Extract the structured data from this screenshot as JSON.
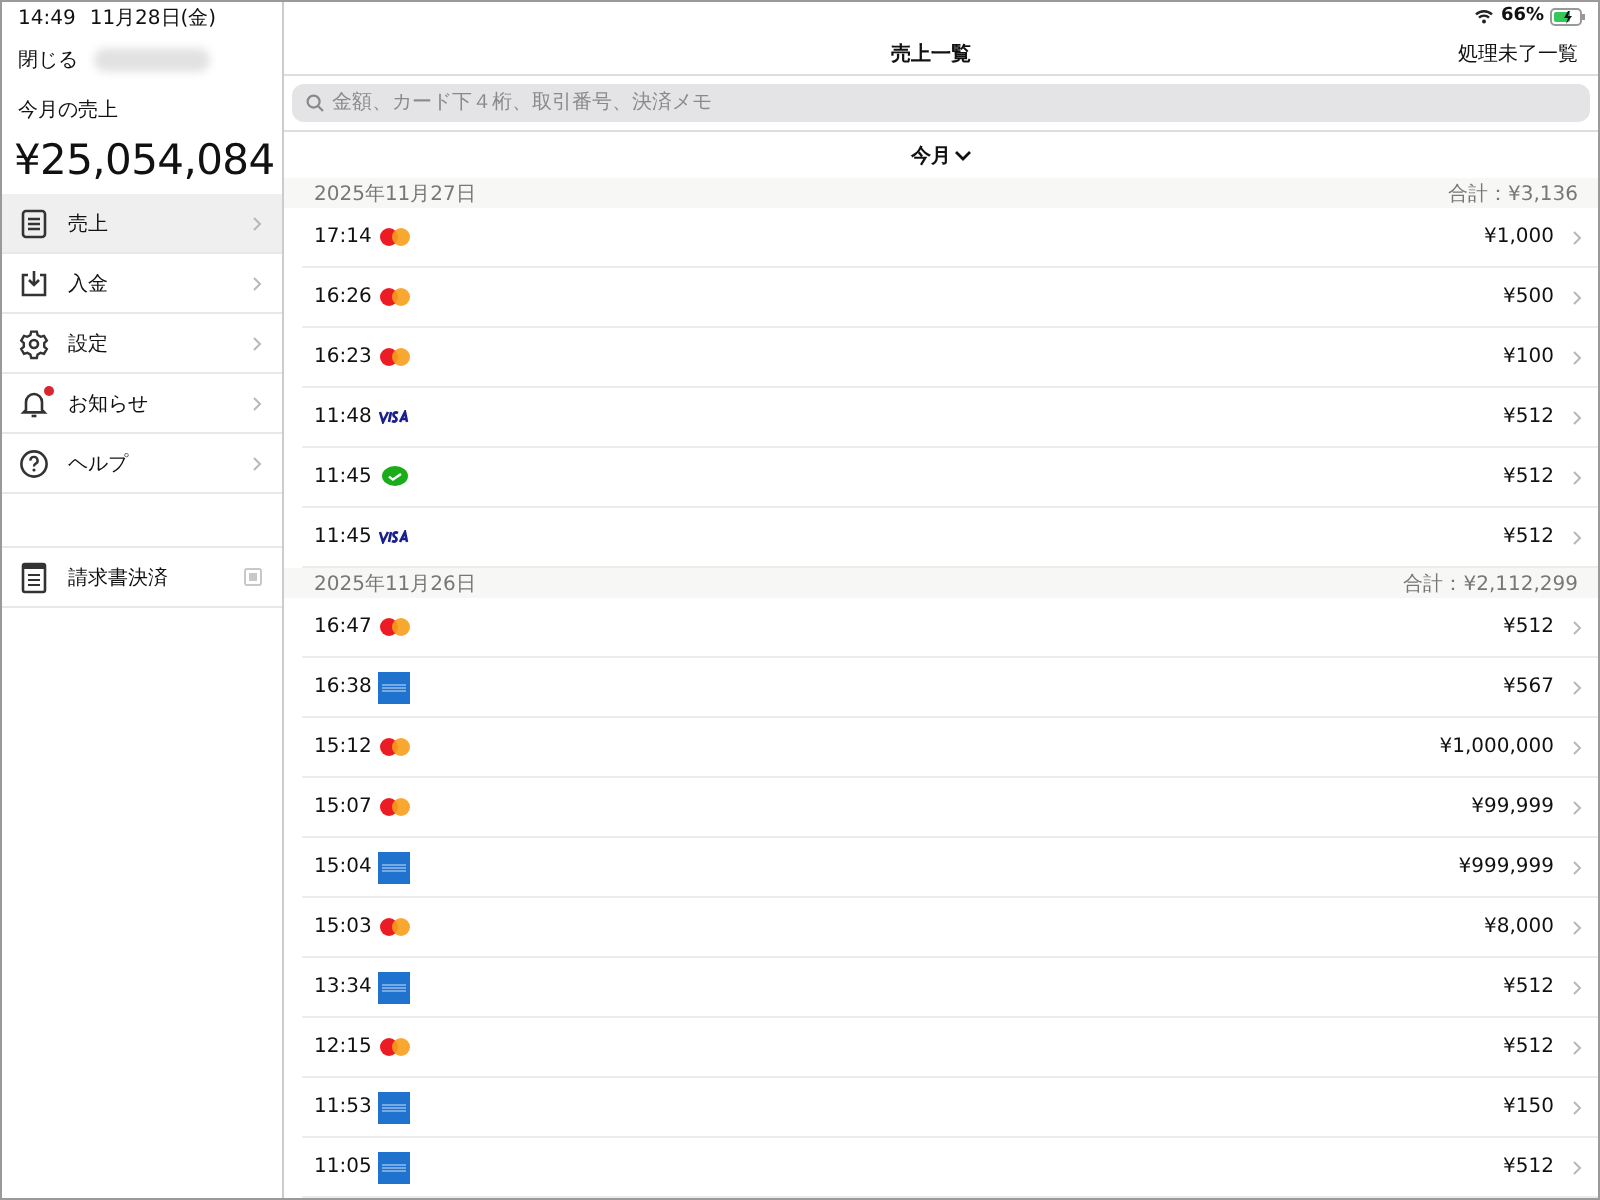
{
  "status_bar": {
    "time": "14:49",
    "date": "11月28日(金)",
    "battery": "66%"
  },
  "sidebar": {
    "close": "閉じる",
    "sales_label": "今月の売上",
    "sales_amount": "¥25,054,084",
    "items": [
      {
        "label": "売上",
        "kind": "document",
        "selected": true,
        "badge": false,
        "external": false
      },
      {
        "label": "入金",
        "kind": "download",
        "selected": false,
        "badge": false,
        "external": false
      },
      {
        "label": "設定",
        "kind": "gear",
        "selected": false,
        "badge": false,
        "external": false
      },
      {
        "label": "お知らせ",
        "kind": "bell",
        "selected": false,
        "badge": true,
        "external": false
      },
      {
        "label": "ヘルプ",
        "kind": "help",
        "selected": false,
        "badge": false,
        "external": false
      }
    ],
    "extra_items": [
      {
        "label": "請求書決済",
        "kind": "invoice",
        "selected": false,
        "badge": false,
        "external": true
      }
    ]
  },
  "header": {
    "title": "売上一覧",
    "action": "処理未了一覧"
  },
  "search": {
    "placeholder": "金額、カード下４桁、取引番号、決済メモ"
  },
  "period": {
    "label": "今月"
  },
  "sections": [
    {
      "date": "2025年11月27日",
      "total": "合計：¥3,136",
      "rows": [
        {
          "time": "17:14",
          "kind": "mastercard",
          "amount": "¥1,000"
        },
        {
          "time": "16:26",
          "kind": "mastercard",
          "amount": "¥500"
        },
        {
          "time": "16:23",
          "kind": "mastercard",
          "amount": "¥100"
        },
        {
          "time": "11:48",
          "kind": "visa",
          "amount": "¥512"
        },
        {
          "time": "11:45",
          "kind": "wechat",
          "amount": "¥512"
        },
        {
          "time": "11:45",
          "kind": "visa",
          "amount": "¥512"
        }
      ]
    },
    {
      "date": "2025年11月26日",
      "total": "合計：¥2,112,299",
      "rows": [
        {
          "time": "16:47",
          "kind": "mastercard",
          "amount": "¥512"
        },
        {
          "time": "16:38",
          "kind": "amex",
          "amount": "¥567"
        },
        {
          "time": "15:12",
          "kind": "mastercard",
          "amount": "¥1,000,000"
        },
        {
          "time": "15:07",
          "kind": "mastercard",
          "amount": "¥99,999"
        },
        {
          "time": "15:04",
          "kind": "amex",
          "amount": "¥999,999"
        },
        {
          "time": "15:03",
          "kind": "mastercard",
          "amount": "¥8,000"
        },
        {
          "time": "13:34",
          "kind": "amex",
          "amount": "¥512"
        },
        {
          "time": "12:15",
          "kind": "mastercard",
          "amount": "¥512"
        },
        {
          "time": "11:53",
          "kind": "amex",
          "amount": "¥150"
        },
        {
          "time": "11:05",
          "kind": "amex",
          "amount": "¥512"
        }
      ]
    }
  ]
}
